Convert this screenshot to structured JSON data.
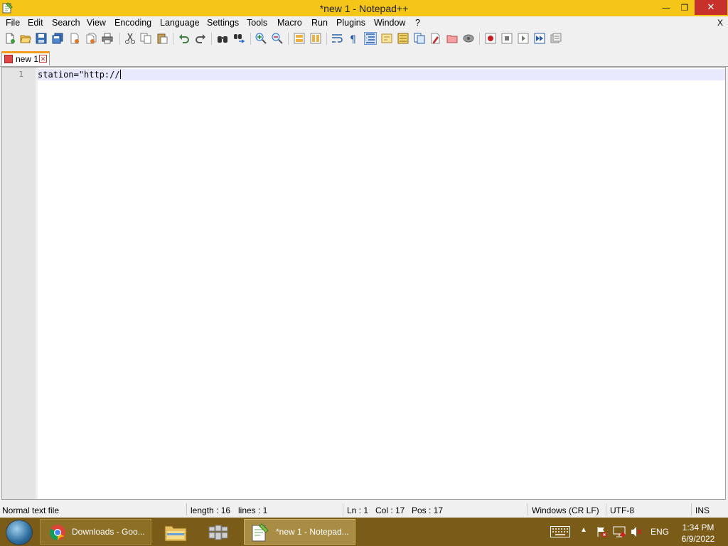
{
  "window": {
    "title": "*new 1 - Notepad++",
    "minimize_glyph": "—",
    "maximize_glyph": "❐",
    "close_glyph": "✕"
  },
  "menu": {
    "items": [
      "File",
      "Edit",
      "Search",
      "View",
      "Encoding",
      "Language",
      "Settings",
      "Tools",
      "Macro",
      "Run",
      "Plugins",
      "Window",
      "?"
    ],
    "close_doc": "X"
  },
  "toolbar": {
    "icons": [
      "new-file-icon",
      "open-file-icon",
      "save-icon",
      "save-all-icon",
      "close-icon",
      "close-all-icon",
      "print-icon",
      "cut-icon",
      "copy-icon",
      "paste-icon",
      "undo-icon",
      "redo-icon",
      "find-icon",
      "replace-icon",
      "zoom-in-icon",
      "zoom-out-icon",
      "sync-vertical-icon",
      "sync-horizontal-icon",
      "word-wrap-icon",
      "show-all-chars-icon",
      "indent-guide-icon",
      "user-language-icon",
      "document-map-icon",
      "function-list-icon",
      "folder-workspace-icon",
      "monitoring-icon",
      "record-macro-icon",
      "stop-record-icon",
      "play-macro-icon",
      "run-macro-multiple-icon",
      "save-macro-icon"
    ]
  },
  "tabs": [
    {
      "label": "new 1",
      "close_glyph": "✕"
    }
  ],
  "editor": {
    "line_number": "1",
    "line_text": "station=\"http://"
  },
  "status": {
    "file_type": "Normal text file",
    "length": "length : 16",
    "lines": "lines : 1",
    "ln": "Ln : 1",
    "col": "Col : 17",
    "pos": "Pos : 17",
    "eol": "Windows (CR LF)",
    "encoding": "UTF-8",
    "mode": "INS"
  },
  "taskbar": {
    "chrome_label": "Downloads - Goo...",
    "notepad_label": "*new 1 - Notepad...",
    "language": "ENG",
    "time": "1:34 PM",
    "date": "6/9/2022"
  },
  "colors": {
    "titlebar": "#f5c518",
    "close_button": "#c7302b",
    "tab_accent": "#f29c1f",
    "taskbar": "#7a5c18",
    "current_line": "#e8e8ff"
  }
}
